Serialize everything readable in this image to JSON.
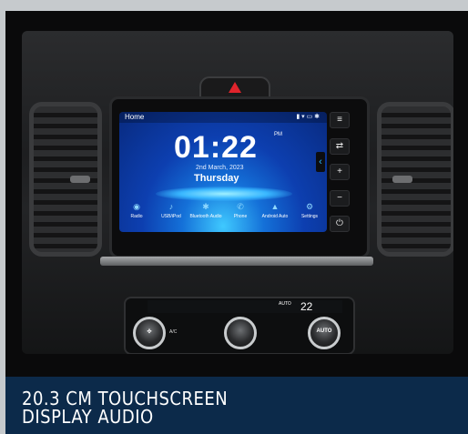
{
  "screen": {
    "home_label": "Home",
    "time": "01:22",
    "time_suffix": "PM",
    "date": "2nd March, 2023",
    "day": "Thursday",
    "apps": [
      "Radio",
      "USB/iPod",
      "Bluetooth Audio",
      "Phone",
      "Android Auto",
      "Settings"
    ]
  },
  "climate": {
    "temperature": "22",
    "auto_label": "AUTO",
    "ac_label": "A/C",
    "auto_button_label": "AUTO"
  },
  "caption": {
    "line1": "20.3 CM TOUCHSCREEN",
    "line2": "DISPLAY AUDIO"
  }
}
